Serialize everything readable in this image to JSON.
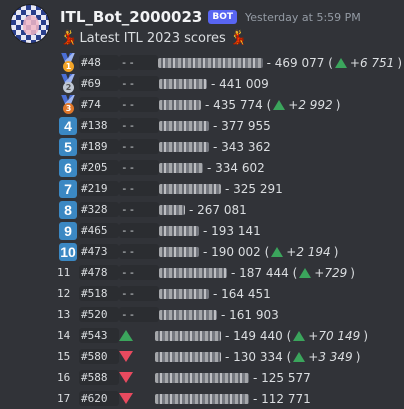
{
  "message": {
    "username": "ITL_Bot_2000023",
    "bot_tag": "BOT",
    "timestamp": "Yesterday at 5:59 PM",
    "title": "Latest ITL 2023 scores",
    "title_left_icon": "dancer-emoji",
    "title_right_icon": "dancer-emoji"
  },
  "rows": [
    {
      "badge": "medal",
      "badge_label": "1",
      "rank": "#48",
      "dashes": "--",
      "score": "- 469 077 (",
      "delta": "+6 751",
      "delta_close": ")",
      "blur_w": 105
    },
    {
      "badge": "medal",
      "badge_label": "2",
      "rank": "#69",
      "dashes": "--",
      "score": "- 441 009",
      "delta": null,
      "blur_w": 48
    },
    {
      "badge": "medal",
      "badge_label": "3",
      "rank": "#74",
      "dashes": "--",
      "score": "- 435 774 (",
      "delta": "+2 992",
      "delta_close": ")",
      "blur_w": 42
    },
    {
      "badge": "keycap",
      "badge_label": "4",
      "rank": "#138",
      "dashes": "--",
      "score": "- 377 955",
      "delta": null,
      "blur_w": 50
    },
    {
      "badge": "keycap",
      "badge_label": "5",
      "rank": "#189",
      "dashes": "--",
      "score": "- 343 362",
      "delta": null,
      "blur_w": 50
    },
    {
      "badge": "keycap",
      "badge_label": "6",
      "rank": "#205",
      "dashes": "--",
      "score": "- 334 602",
      "delta": null,
      "blur_w": 44
    },
    {
      "badge": "keycap",
      "badge_label": "7",
      "rank": "#219",
      "dashes": "--",
      "score": "- 325 291",
      "delta": null,
      "blur_w": 62
    },
    {
      "badge": "keycap",
      "badge_label": "8",
      "rank": "#328",
      "dashes": "--",
      "score": "- 267 081",
      "delta": null,
      "blur_w": 26
    },
    {
      "badge": "keycap",
      "badge_label": "9",
      "rank": "#465",
      "dashes": "--",
      "score": "- 193 141",
      "delta": null,
      "blur_w": 40
    },
    {
      "badge": "keycap",
      "badge_label": "10",
      "rank": "#473",
      "dashes": "--",
      "score": "- 190 002 (",
      "delta": "+2 194",
      "delta_close": ")",
      "blur_w": 40
    },
    {
      "badge": "plain",
      "badge_label": "11",
      "rank": "#478",
      "dashes": "--",
      "score": "- 187 444 (",
      "delta": "+729",
      "delta_close": ")",
      "blur_w": 68
    },
    {
      "badge": "plain",
      "badge_label": "12",
      "rank": "#518",
      "dashes": "--",
      "score": "- 164 451",
      "delta": null,
      "blur_w": 50
    },
    {
      "badge": "plain",
      "badge_label": "13",
      "rank": "#520",
      "dashes": "--",
      "score": "- 161 903",
      "delta": null,
      "blur_w": 58
    },
    {
      "badge": "plain",
      "badge_label": "14",
      "rank": "#543",
      "dashes": "",
      "score": "- 149 440 (",
      "delta": "+70 149",
      "delta_close": ")",
      "blur_w": 66,
      "move": "up"
    },
    {
      "badge": "plain",
      "badge_label": "15",
      "rank": "#580",
      "dashes": "",
      "score": "- 130 334 (",
      "delta": "+3 349",
      "delta_close": ")",
      "blur_w": 66,
      "move": "down"
    },
    {
      "badge": "plain",
      "badge_label": "16",
      "rank": "#588",
      "dashes": "",
      "score": "- 125 577",
      "delta": null,
      "blur_w": 94,
      "move": "down"
    },
    {
      "badge": "plain",
      "badge_label": "17",
      "rank": "#620",
      "dashes": "",
      "score": "- 112 771",
      "delta": null,
      "blur_w": 94,
      "move": "down"
    }
  ],
  "colors": {
    "background": "#313338",
    "keycap": "#3b88c3",
    "up": "#3ba55c",
    "down": "#e84a5f",
    "bot_tag": "#5865f2"
  }
}
